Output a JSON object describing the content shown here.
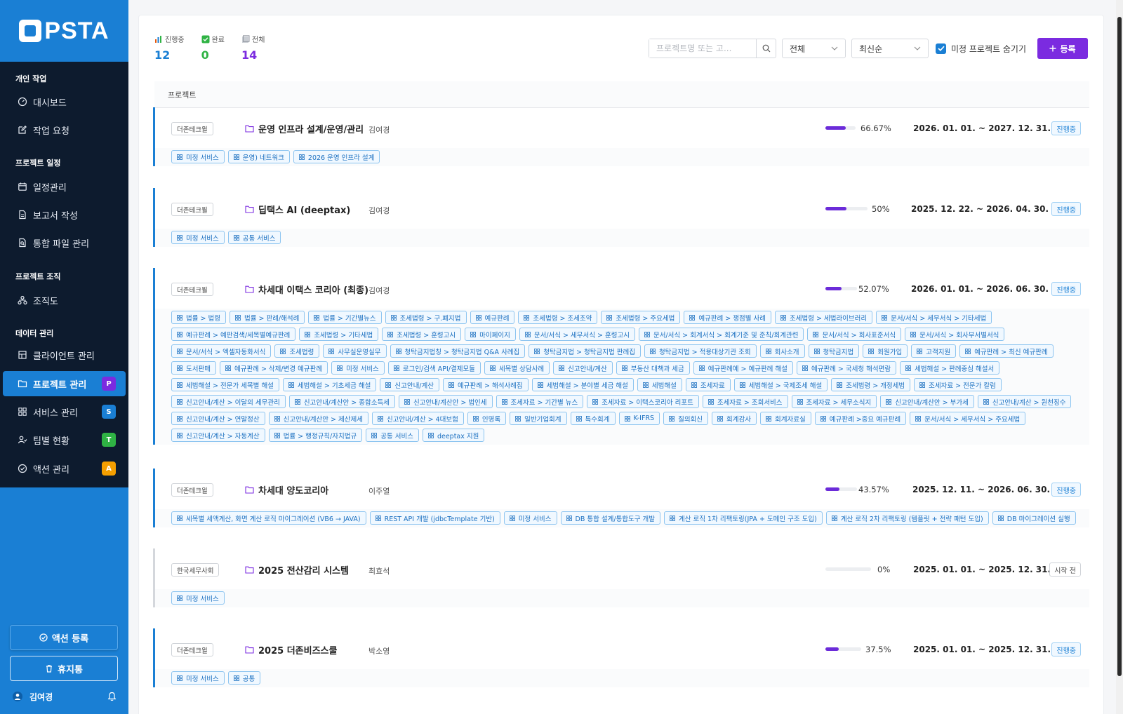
{
  "app": {
    "logo_text": "PSTA"
  },
  "sidebar": {
    "sections": [
      {
        "title": "개인 작업",
        "items": [
          {
            "label": "대시보드",
            "icon": "gauge-icon"
          },
          {
            "label": "작업 요청",
            "icon": "edit-icon"
          }
        ]
      },
      {
        "title": "프로젝트 일정",
        "items": [
          {
            "label": "일정관리",
            "icon": "calendar-icon"
          },
          {
            "label": "보고서 작성",
            "icon": "document-icon"
          },
          {
            "label": "통합 파일 관리",
            "icon": "file-search-icon"
          }
        ]
      },
      {
        "title": "프로젝트 조직",
        "items": [
          {
            "label": "조직도",
            "icon": "org-chart-icon"
          }
        ]
      },
      {
        "title": "데이터 관리",
        "items": [
          {
            "label": "클라이언트 관리",
            "icon": "building-icon"
          },
          {
            "label": "프로젝트 관리",
            "icon": "folder-icon",
            "badge": "P",
            "badge_color": "#7b2be0",
            "active": true
          },
          {
            "label": "서비스 관리",
            "icon": "grid-icon",
            "badge": "S",
            "badge_color": "#1a7fd4"
          },
          {
            "label": "팀별 현황",
            "icon": "user-group-icon",
            "badge": "T",
            "badge_color": "#2fb344"
          },
          {
            "label": "액션 관리",
            "icon": "check-circle-icon",
            "badge": "A",
            "badge_color": "#f59f00"
          }
        ]
      }
    ],
    "action_button": "액션 등록",
    "trash_button": "휴지통",
    "user_name": "김여경"
  },
  "stats": [
    {
      "label": "진행중",
      "value": "12",
      "color": "#1a7fd4",
      "icon": "bar-chart-icon"
    },
    {
      "label": "완료",
      "value": "0",
      "color": "#2fb344",
      "icon": "check-box-icon"
    },
    {
      "label": "전체",
      "value": "14",
      "color": "#7b2be0",
      "icon": "folder-stack-icon"
    }
  ],
  "toolbar": {
    "search_placeholder": "프로젝트명 또는 고...",
    "filter_value": "전체",
    "sort_value": "최신순",
    "hide_label": "미정 프로젝트 숨기기",
    "register_label": "등록"
  },
  "table": {
    "header": "프로젝트"
  },
  "projects": [
    {
      "org": "더존테크윌",
      "title": "운영 인프라 설계/운영/관리",
      "owner": "김여경",
      "progress": 0.6667,
      "pct": "66.67%",
      "period": "2026. 01. 01. ~ 2027. 12. 31.",
      "status": "진행중",
      "tags": [
        "미정 서비스",
        "운영) 네트워크",
        "2026 운영 인프라 설계"
      ]
    },
    {
      "org": "더존테크윌",
      "title": "딥택스 AI (deeptax)",
      "owner": "김여경",
      "progress": 0.5,
      "pct": "50%",
      "period": "2025. 12. 22. ~ 2026. 04. 30.",
      "status": "진행중",
      "tags": [
        "미정 서비스",
        "공통 서비스"
      ]
    },
    {
      "org": "더존테크윌",
      "title": "차세대 이택스 코리아 (최종)",
      "owner": "김여경",
      "progress": 0.5207,
      "pct": "52.07%",
      "period": "2026. 01. 01. ~ 2026. 06. 30.",
      "status": "진행중",
      "tags": [
        "법률 > 법령",
        "법률 > 판례/해석례",
        "법률 > 기간별뉴스",
        "조세법령 > 구.폐지법",
        "예규판례",
        "조세법령 > 조세조약",
        "조세법령 > 주요세법",
        "예규판례 > 쟁점별 사례",
        "조세법령 > 세법라이브러리",
        "문서/서식 > 세무서식 > 기타세법",
        "예규판례 > 예판검색/세목별예규판례",
        "조세법령 > 기타세법",
        "조세법령 > 훈령고시",
        "마이페이지",
        "문서/서식 > 세무서식 > 훈령고시",
        "문서/서식 > 회계서식 > 회계기준 및 준칙/회계관련",
        "문서/서식 > 회사표준서식",
        "문서/서식 > 회사부서별서식",
        "문서/서식 > 엑셀자동화서식",
        "조세법령",
        "사무실운영실무",
        "청탁금지법칭 > 청탁금지법 Q&A 사례집",
        "청탁금지법 > 청탁금지법 판례집",
        "청탁금지법 > 적용대상기관 조회",
        "회사소개",
        "청탁금지법",
        "회원가입",
        "고객지원",
        "예규판례 > 최신 예규판례",
        "도서판매",
        "예규판례 > 삭제/변경 예규판례",
        "미정 서비스",
        "로그인/검색 API/결제모듈",
        "세목별 상담사례",
        "신고안내/계산",
        "부동산 대책과 세금",
        "예규판례예 > 예규판례 해설",
        "예규판례 > 국세청 해석편람",
        "세법해설 > 판례중심 해설서",
        "세법해설 > 전문가 세목별 해설",
        "세법해설 > 기초세금 해설",
        "신고안내/계산",
        "예규판례 > 해석사례집",
        "세법해설 > 분야별 세금 해설",
        "세법해설",
        "조세자료",
        "세법해설 > 국제조세 해설",
        "조세법령 > 개정세법",
        "조세자료 > 전문가 칼럼",
        "신고안내/계산 > 이달의 세무관리",
        "신고안내/계산안 > 종합소득세",
        "신고안내/계산안 > 법인세",
        "조세자료 > 기간별 뉴스",
        "조세자료 > 이택스코리아 리포트",
        "조세자료 > 조회서비스",
        "조세자료 > 세무소식지",
        "신고안내/계산안 > 부가세",
        "신고안내/계산 > 원천징수",
        "신고안내/계산 > 연말정산",
        "신고안내/계산안 > 제산제세",
        "신고안내/계산 > 4대보험",
        "인명록",
        "일반기업회계",
        "특수회계",
        "K-IFRS",
        "질의회신",
        "회계감사",
        "회계자료실",
        "예규판례 >중요 예규판례",
        "문서/서식 > 세무서식 > 주요세법",
        "신고안내/계산 > 자동계산",
        "법률 > 행정규칙/자치법규",
        "공통 서비스",
        "deeptax 지원"
      ]
    },
    {
      "org": "더존테크윌",
      "title": "차세대 양도코리아",
      "owner": "이주열",
      "progress": 0.4357,
      "pct": "43.57%",
      "period": "2025. 12. 11. ~ 2026. 06. 30.",
      "status": "진행중",
      "tags": [
        "세목별 세액계산, 화면 계산 로직 마이그레이션 (VB6 → JAVA)",
        "REST API 개발 (jdbcTemplate 기반)",
        "미정 서비스",
        "DB 통합 설계/통합도구 개발",
        "계산 로직 1차 리팩토링(JPA + 도메인 구조 도입)",
        "계산 로직 2차 리팩토링 (템플릿 + 전략 패턴 도입)",
        "DB 마이그레이션 실행"
      ]
    },
    {
      "org": "한국세무사회",
      "title": "2025 전산감리 시스템",
      "owner": "최효석",
      "progress": 0,
      "pct": "0%",
      "period": "2025. 01. 01. ~ 2025. 12. 31.",
      "status": "시작 전",
      "tags": [
        "미정 서비스"
      ]
    },
    {
      "org": "더존테크윌",
      "title": "2025 더존비즈스쿨",
      "owner": "박소영",
      "progress": 0.375,
      "pct": "37.5%",
      "period": "2025. 01. 01. ~ 2025. 12. 31.",
      "status": "진행중",
      "tags": [
        "미정 서비스",
        "공통"
      ]
    }
  ]
}
